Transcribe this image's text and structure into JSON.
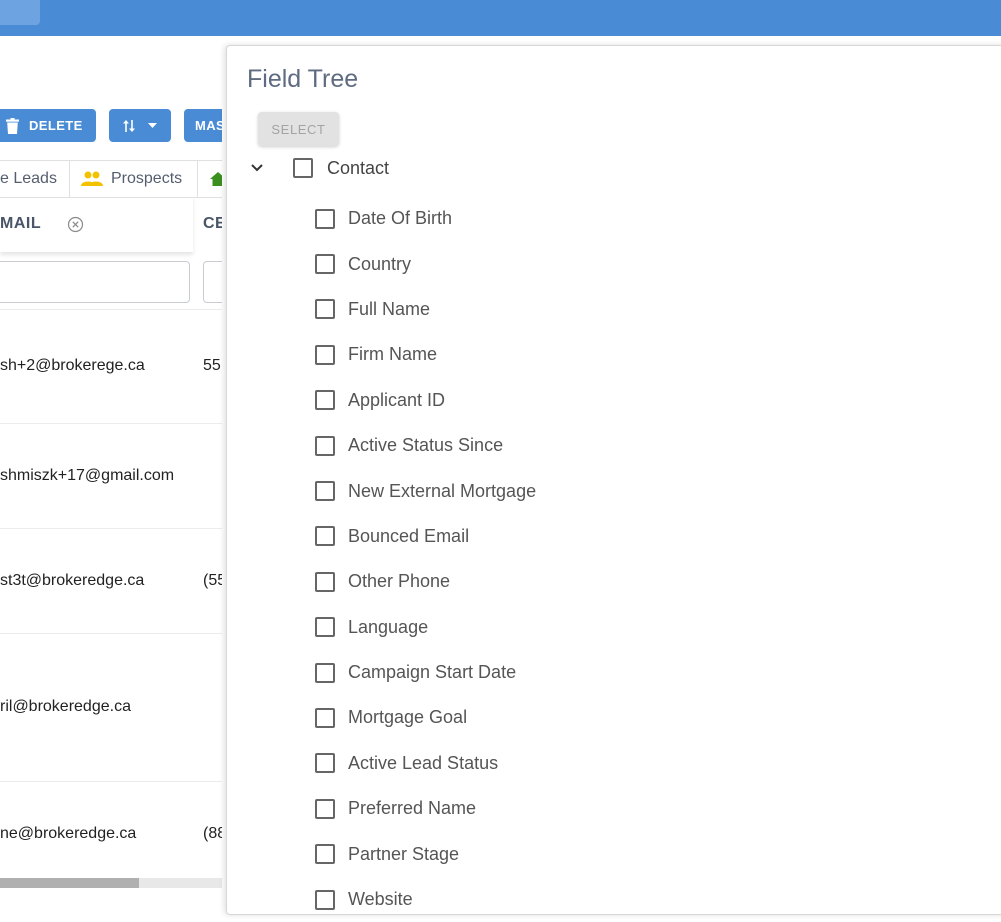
{
  "toolbar": {
    "delete_label": "DELETE",
    "mass_label": "MAS"
  },
  "tabs": [
    {
      "label": "e Leads"
    },
    {
      "label": "Prospects"
    }
  ],
  "columns": {
    "email": "MAIL",
    "cell": "CE"
  },
  "rows": [
    {
      "email": "sh+2@brokerege.ca",
      "cell": "55"
    },
    {
      "email": "shmiszk+17@gmail.com",
      "cell": ""
    },
    {
      "email": "st3t@brokeredge.ca",
      "cell": "(55"
    },
    {
      "email": "ril@brokeredge.ca",
      "cell": ""
    },
    {
      "email": "ne@brokeredge.ca",
      "cell": "(88"
    }
  ],
  "dialog": {
    "title": "Field Tree",
    "select_label": "SELECT",
    "root": {
      "label": "Contact"
    },
    "children": [
      {
        "label": "Date Of Birth"
      },
      {
        "label": "Country"
      },
      {
        "label": "Full Name"
      },
      {
        "label": "Firm Name"
      },
      {
        "label": "Applicant ID"
      },
      {
        "label": "Active Status Since"
      },
      {
        "label": "New External Mortgage"
      },
      {
        "label": "Bounced Email"
      },
      {
        "label": "Other Phone"
      },
      {
        "label": "Language"
      },
      {
        "label": "Campaign Start Date"
      },
      {
        "label": "Mortgage Goal"
      },
      {
        "label": "Active Lead Status"
      },
      {
        "label": "Preferred Name"
      },
      {
        "label": "Partner Stage"
      },
      {
        "label": "Website"
      }
    ]
  },
  "colors": {
    "primary": "#4a8bd6",
    "prospects_icon": "#f2c200",
    "next_tab_icon": "#3a8f1e"
  }
}
